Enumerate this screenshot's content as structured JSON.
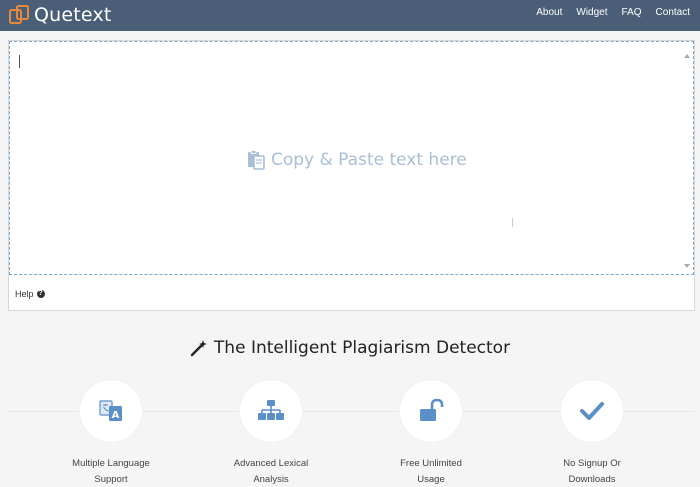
{
  "header": {
    "brand": "Quetext",
    "nav": [
      "About",
      "Widget",
      "FAQ",
      "Contact"
    ]
  },
  "editor": {
    "placeholder": "Copy & Paste text here",
    "help_label": "Help"
  },
  "tagline": "The Intelligent Plagiarism Detector",
  "features": [
    {
      "line1": "Multiple Language",
      "line2": "Support",
      "icon": "translate-icon"
    },
    {
      "line1": "Advanced Lexical",
      "line2": "Analysis",
      "icon": "sitemap-icon"
    },
    {
      "line1": "Free Unlimited",
      "line2": "Usage",
      "icon": "unlock-icon"
    },
    {
      "line1": "No Signup Or",
      "line2": "Downloads",
      "icon": "checkmark-icon"
    }
  ],
  "colors": {
    "header_bg": "#4a5e78",
    "accent": "#5b8fc7",
    "logo": "#e8883a",
    "placeholder": "#a9bfd6"
  }
}
